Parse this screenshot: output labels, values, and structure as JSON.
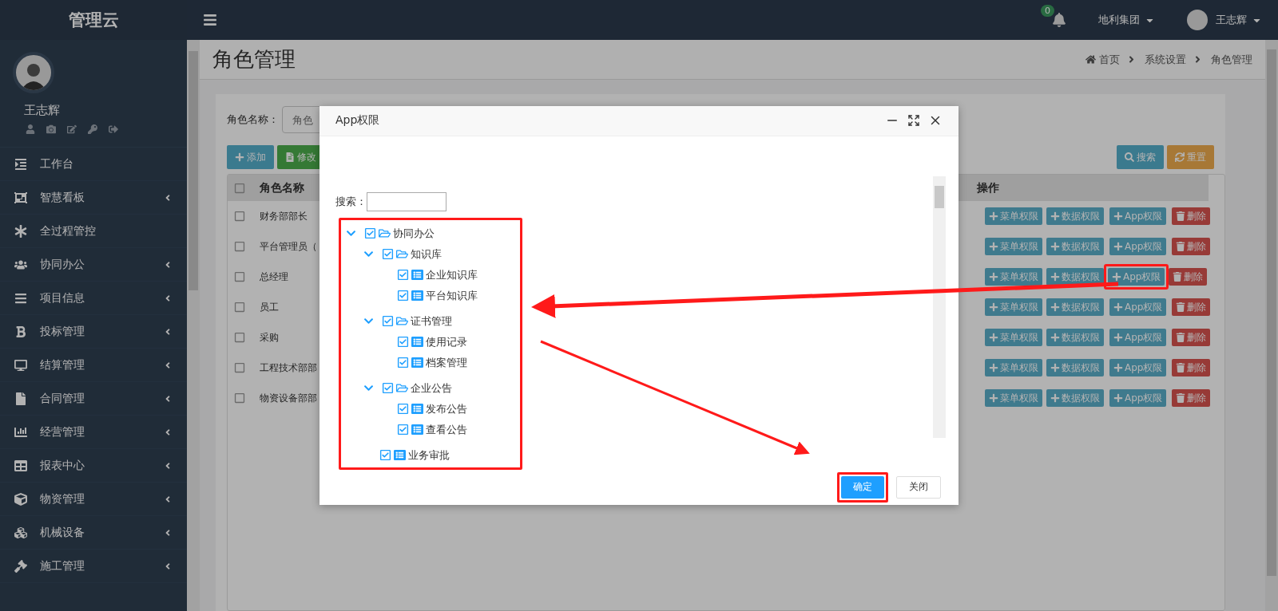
{
  "app": {
    "logo": "管理云"
  },
  "topbar": {
    "notification_count": "0",
    "company": "地利集团",
    "user": "王志辉"
  },
  "sidebar": {
    "user_name": "王志辉",
    "items": [
      {
        "label": "工作台",
        "has_submenu": false
      },
      {
        "label": "智慧看板",
        "has_submenu": true
      },
      {
        "label": "全过程管控",
        "has_submenu": false
      },
      {
        "label": "协同办公",
        "has_submenu": true
      },
      {
        "label": "项目信息",
        "has_submenu": true
      },
      {
        "label": "投标管理",
        "has_submenu": true
      },
      {
        "label": "结算管理",
        "has_submenu": true
      },
      {
        "label": "合同管理",
        "has_submenu": true
      },
      {
        "label": "经营管理",
        "has_submenu": true
      },
      {
        "label": "报表中心",
        "has_submenu": true
      },
      {
        "label": "物资管理",
        "has_submenu": true
      },
      {
        "label": "机械设备",
        "has_submenu": true
      },
      {
        "label": "施工管理",
        "has_submenu": true
      }
    ]
  },
  "page": {
    "title": "角色管理",
    "breadcrumb": [
      "首页",
      "系统设置",
      "角色管理"
    ]
  },
  "filter": {
    "label": "角色名称：",
    "placeholder": "角色"
  },
  "toolbar": [
    {
      "label": "添加",
      "kind": "add"
    },
    {
      "label": "修改",
      "kind": "edit"
    }
  ],
  "search_buttons": [
    {
      "label": "搜索",
      "kind": "search"
    },
    {
      "label": "重置",
      "kind": "reset"
    }
  ],
  "table": {
    "columns": [
      "角色名称",
      "操作"
    ],
    "header_checked": false,
    "rows": [
      {
        "name": "财务部部长",
        "checked": false,
        "app_highlighted": false,
        "actions": [
          "菜单权限",
          "数据权限",
          "App权限",
          "删除"
        ]
      },
      {
        "name": "平台管理员（",
        "checked": false,
        "app_highlighted": false,
        "actions": [
          "菜单权限",
          "数据权限",
          "App权限",
          "删除"
        ]
      },
      {
        "name": "总经理",
        "checked": false,
        "app_highlighted": true,
        "actions": [
          "菜单权限",
          "数据权限",
          "App权限",
          "删除"
        ]
      },
      {
        "name": "员工",
        "checked": false,
        "app_highlighted": false,
        "actions": [
          "菜单权限",
          "数据权限",
          "App权限",
          "删除"
        ]
      },
      {
        "name": "采购",
        "checked": false,
        "app_highlighted": false,
        "actions": [
          "菜单权限",
          "数据权限",
          "App权限",
          "删除"
        ]
      },
      {
        "name": "工程技术部部",
        "checked": false,
        "app_highlighted": false,
        "actions": [
          "菜单权限",
          "数据权限",
          "App权限",
          "删除"
        ]
      },
      {
        "name": "物资设备部部",
        "checked": false,
        "app_highlighted": false,
        "actions": [
          "菜单权限",
          "数据权限",
          "App权限",
          "删除"
        ]
      }
    ]
  },
  "modal": {
    "title": "App权限",
    "search_label": "搜索：",
    "tree_highlighted": true,
    "tree": [
      {
        "label": "协同办公",
        "checked": true,
        "expanded": true,
        "children": [
          {
            "label": "知识库",
            "checked": true,
            "expanded": true,
            "children": [
              {
                "label": "企业知识库",
                "checked": true
              },
              {
                "label": "平台知识库",
                "checked": true
              }
            ]
          },
          {
            "label": "证书管理",
            "checked": true,
            "expanded": true,
            "children": [
              {
                "label": "使用记录",
                "checked": true
              },
              {
                "label": "档案管理",
                "checked": true
              }
            ]
          },
          {
            "label": "企业公告",
            "checked": true,
            "expanded": true,
            "children": [
              {
                "label": "发布公告",
                "checked": true
              },
              {
                "label": "查看公告",
                "checked": true
              }
            ]
          },
          {
            "label": "业务审批",
            "checked": true
          }
        ]
      }
    ],
    "buttons": [
      {
        "label": "确定",
        "kind": "primary",
        "highlighted": true
      },
      {
        "label": "关闭",
        "kind": "default",
        "highlighted": false
      }
    ]
  }
}
